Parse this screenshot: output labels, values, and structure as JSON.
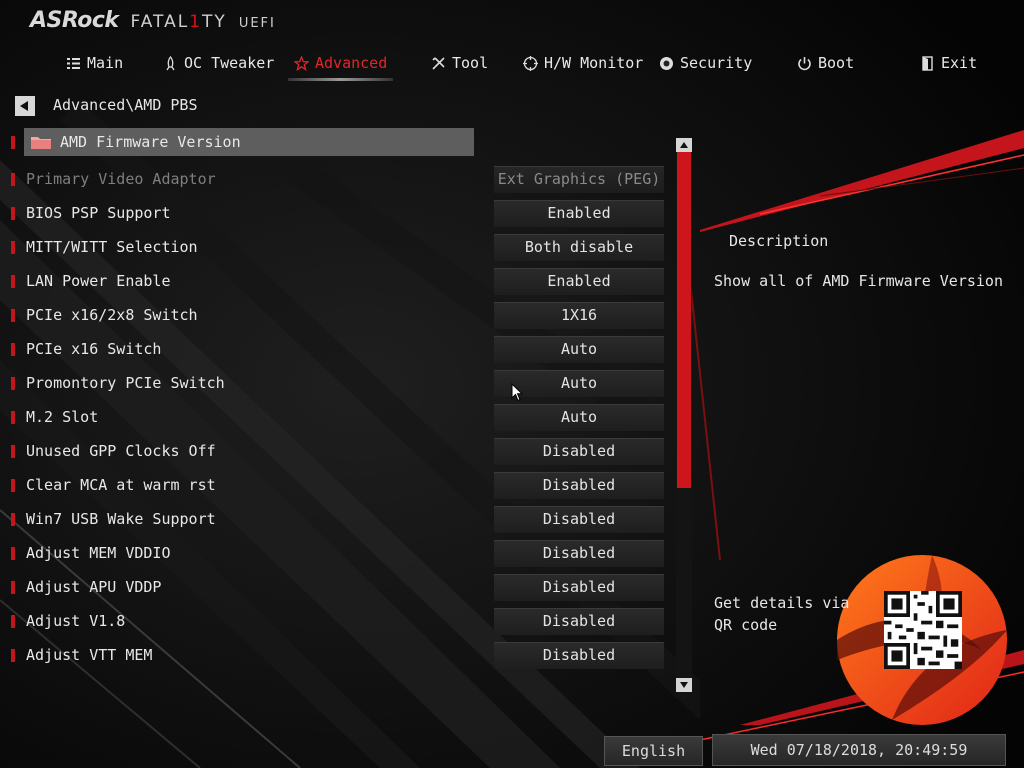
{
  "brand": {
    "asrock": "ASRock",
    "fatality_pre": "FATAL",
    "fatality_one": "1",
    "fatality_post": "TY",
    "uefi": "UEFI"
  },
  "tabs": [
    {
      "label": "Main",
      "icon": "list-icon",
      "active": false
    },
    {
      "label": "OC Tweaker",
      "icon": "rocket-icon",
      "active": false
    },
    {
      "label": "Advanced",
      "icon": "star-icon",
      "active": true
    },
    {
      "label": "Tool",
      "icon": "tools-icon",
      "active": false
    },
    {
      "label": "H/W Monitor",
      "icon": "crosshair-icon",
      "active": false
    },
    {
      "label": "Security",
      "icon": "shield-gear-icon",
      "active": false
    },
    {
      "label": "Boot",
      "icon": "power-icon",
      "active": false
    },
    {
      "label": "Exit",
      "icon": "exit-door-icon",
      "active": false
    }
  ],
  "breadcrumb": "Advanced\\AMD PBS",
  "settings": [
    {
      "label": "AMD Firmware Version",
      "value": null,
      "type": "folder",
      "selected": true
    },
    {
      "label": "Primary Video Adaptor",
      "value": "Ext Graphics (PEG)",
      "disabled": true
    },
    {
      "label": "BIOS PSP Support",
      "value": "Enabled"
    },
    {
      "label": "MITT/WITT Selection",
      "value": "Both disable"
    },
    {
      "label": "LAN Power Enable",
      "value": "Enabled"
    },
    {
      "label": "PCIe x16/2x8 Switch",
      "value": "1X16"
    },
    {
      "label": "PCIe x16 Switch",
      "value": "Auto"
    },
    {
      "label": "Promontory PCIe Switch",
      "value": "Auto"
    },
    {
      "label": "M.2 Slot",
      "value": "Auto"
    },
    {
      "label": "Unused GPP Clocks Off",
      "value": "Disabled"
    },
    {
      "label": "Clear MCA at warm rst",
      "value": "Disabled"
    },
    {
      "label": "Win7 USB Wake Support",
      "value": "Disabled"
    },
    {
      "label": "Adjust MEM VDDIO",
      "value": "Disabled"
    },
    {
      "label": "Adjust APU VDDP",
      "value": "Disabled"
    },
    {
      "label": "Adjust V1.8",
      "value": "Disabled"
    },
    {
      "label": "Adjust VTT MEM",
      "value": "Disabled"
    }
  ],
  "description": {
    "title": "Description",
    "text": "Show all of AMD Firmware Version",
    "qr_text": "Get details via QR code"
  },
  "footer": {
    "language": "English",
    "datetime": "Wed 07/18/2018, 20:49:59"
  },
  "colors": {
    "accent": "#cc161c",
    "highlight": "#5e5e5e",
    "background": "#050505"
  }
}
